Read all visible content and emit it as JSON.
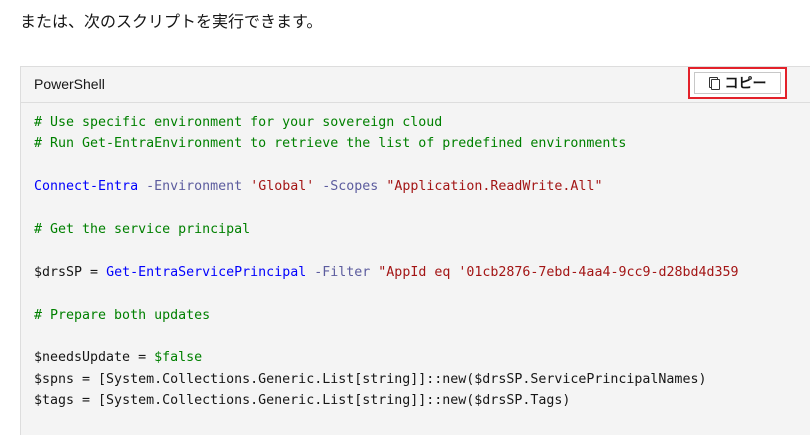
{
  "intro_text": "または、次のスクリプトを実行できます。",
  "code_block": {
    "language": "PowerShell",
    "copy_label": "コピー",
    "copy_icon": "copy-icon",
    "lines": [
      [
        {
          "t": "comment",
          "v": "# Use specific environment for your sovereign cloud"
        }
      ],
      [
        {
          "t": "comment",
          "v": "# Run Get-EntraEnvironment to retrieve the list of predefined environments"
        }
      ],
      [],
      [
        {
          "t": "cmd",
          "v": "Connect-Entra"
        },
        {
          "t": "plain",
          "v": " "
        },
        {
          "t": "param",
          "v": "-Environment"
        },
        {
          "t": "plain",
          "v": " "
        },
        {
          "t": "str",
          "v": "'Global'"
        },
        {
          "t": "plain",
          "v": " "
        },
        {
          "t": "param",
          "v": "-Scopes"
        },
        {
          "t": "plain",
          "v": " "
        },
        {
          "t": "str",
          "v": "\"Application.ReadWrite.All\""
        }
      ],
      [],
      [
        {
          "t": "comment",
          "v": "# Get the service principal"
        }
      ],
      [],
      [
        {
          "t": "var",
          "v": "$drsSP"
        },
        {
          "t": "plain",
          "v": " = "
        },
        {
          "t": "cmd",
          "v": "Get-EntraServicePrincipal"
        },
        {
          "t": "plain",
          "v": " "
        },
        {
          "t": "param",
          "v": "-Filter"
        },
        {
          "t": "plain",
          "v": " "
        },
        {
          "t": "str",
          "v": "\"AppId eq '01cb2876-7ebd-4aa4-9cc9-d28bd4d359"
        }
      ],
      [],
      [
        {
          "t": "comment",
          "v": "# Prepare both updates"
        }
      ],
      [],
      [
        {
          "t": "var",
          "v": "$needsUpdate"
        },
        {
          "t": "plain",
          "v": " = "
        },
        {
          "t": "bool",
          "v": "$false"
        }
      ],
      [
        {
          "t": "var",
          "v": "$spns"
        },
        {
          "t": "plain",
          "v": " = [System.Collections.Generic.List[string]]::new($drsSP.ServicePrincipalNames)"
        }
      ],
      [
        {
          "t": "var",
          "v": "$tags"
        },
        {
          "t": "plain",
          "v": " = [System.Collections.Generic.List[string]]::new($drsSP.Tags)"
        }
      ]
    ]
  }
}
